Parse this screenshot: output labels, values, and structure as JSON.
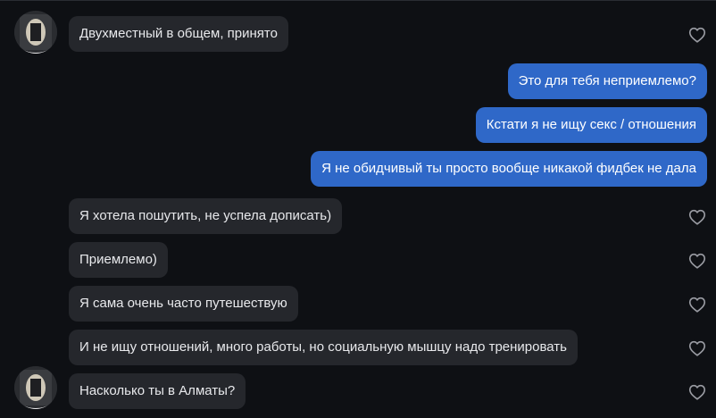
{
  "messages": [
    {
      "direction": "incoming",
      "text": "Двухместный в общем, принято",
      "avatar": true,
      "liked": false
    },
    {
      "direction": "outgoing",
      "text": "Это для тебя неприемлемо?"
    },
    {
      "direction": "outgoing",
      "text": "Кстати я не ищу секс / отношения"
    },
    {
      "direction": "outgoing",
      "text": "Я не обидчивый ты просто вообще никакой фидбек не дала"
    },
    {
      "direction": "incoming",
      "text": "Я хотела пошутить, не успела дописать)",
      "avatar": false,
      "liked": false
    },
    {
      "direction": "incoming",
      "text": "Приемлемо)",
      "avatar": false,
      "liked": false
    },
    {
      "direction": "incoming",
      "text": "Я сама очень часто путешествую",
      "avatar": false,
      "liked": false
    },
    {
      "direction": "incoming",
      "text": "И не ищу отношений, много работы, но социальную мышцу надо тренировать",
      "avatar": false,
      "liked": false
    },
    {
      "direction": "incoming",
      "text": "Насколько ты в Алматы?",
      "avatar": true,
      "liked": false
    }
  ],
  "colors": {
    "background": "#0e1014",
    "incoming_bubble": "#25272c",
    "outgoing_bubble": "#2f68c8",
    "heart_outline": "#9a9ca3"
  },
  "icons": {
    "avatar": "contact-avatar",
    "like": "heart-outline-icon"
  }
}
